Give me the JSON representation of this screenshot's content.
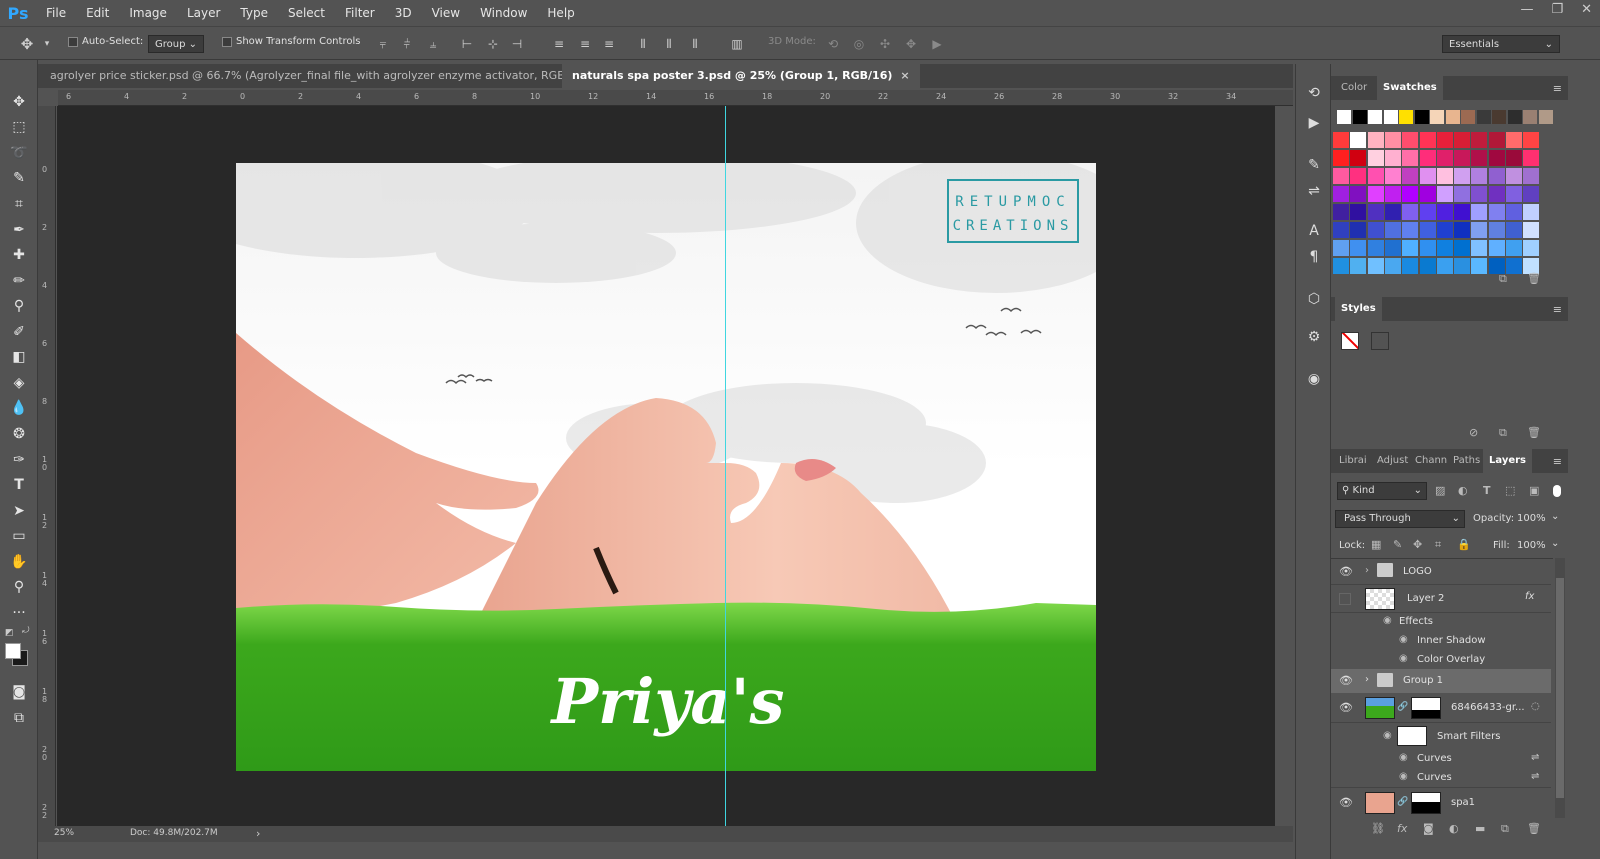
{
  "app": {
    "logo": "Ps"
  },
  "menu": [
    "File",
    "Edit",
    "Image",
    "Layer",
    "Type",
    "Select",
    "Filter",
    "3D",
    "View",
    "Window",
    "Help"
  ],
  "window_controls": {
    "minimize": "—",
    "restore": "❐",
    "close": "✕"
  },
  "options": {
    "auto_select_label": "Auto-Select:",
    "auto_select_value": "Group",
    "show_transform_label": "Show Transform Controls",
    "mode_3d_label": "3D Mode:",
    "workspace_value": "Essentials"
  },
  "tabs": [
    {
      "label": "agrolyer price sticker.psd @ 66.7% (Agrolyzer_final file_with agrolyzer enzyme activator, RGB/8)",
      "close": "×",
      "active": false
    },
    {
      "label": "naturals spa poster 3.psd @ 25% (Group 1, RGB/16)",
      "close": "×",
      "active": true
    }
  ],
  "ruler": {
    "h_labels": [
      "6",
      "4",
      "2",
      "0",
      "2",
      "4",
      "6",
      "8",
      "10",
      "12",
      "14",
      "16",
      "18",
      "20",
      "22",
      "24",
      "26",
      "28",
      "30",
      "32",
      "34"
    ],
    "v_labels": [
      "0",
      "2",
      "4",
      "6",
      "8",
      "1 0",
      "1 2",
      "1 4",
      "1 6",
      "1 8",
      "2 0",
      "2 2"
    ]
  },
  "poster": {
    "logo_line1": "RETUPMOC",
    "logo_line2": "CREATIONS",
    "brand_script": "Priya's"
  },
  "status": {
    "zoom": "25%",
    "doc": "Doc: 49.8M/202.7M",
    "arrow": "›"
  },
  "panels": {
    "color_tab": "Color",
    "swatches_tab": "Swatches",
    "styles_tab": "Styles",
    "layer_tabs": [
      "Librai",
      "Adjust",
      "Chann",
      "Paths",
      "Layers"
    ],
    "kind_label": "Kind",
    "blend_mode": "Pass Through",
    "opacity_label": "Opacity:",
    "opacity_value": "100%",
    "lock_label": "Lock:",
    "fill_label": "Fill:",
    "fill_value": "100%"
  },
  "swatches": {
    "top_row": [
      "#ffffff",
      "#000000",
      "#ffffff",
      "#ffffff",
      "#ffe000",
      "#000000",
      "#f5d5b8",
      "#e8b58f",
      "#9c6a52",
      "#3a3a3a",
      "#4a3a30",
      "#2d2d2d",
      "#9a8072",
      "#b09a88"
    ],
    "rows": [
      [
        "#ff3b3b",
        "#ffffff",
        "#ffb3c0",
        "#ff8fa3",
        "#ff4d6d",
        "#ff3355",
        "#e8203a",
        "#d81e35",
        "#c01c3c",
        "#b01838",
        "#ff6b6b",
        "#ff4444"
      ],
      [
        "#ff2020",
        "#d00010",
        "#ffd0e0",
        "#ffb0d0",
        "#ff6fa8",
        "#ff2d7a",
        "#e0206a",
        "#c8185a",
        "#b0104a",
        "#a00840",
        "#9a0a3a",
        "#ff3070"
      ],
      [
        "#ff5aa0",
        "#ff3080",
        "#ff50b0",
        "#ff80d0",
        "#c040c0",
        "#e090f0",
        "#ffc0e0",
        "#d0a0f0",
        "#b080e0",
        "#9060d0",
        "#c090e0",
        "#a070d0"
      ],
      [
        "#a020e0",
        "#8010c0",
        "#e040ff",
        "#c020f0",
        "#b000ff",
        "#a000e0",
        "#d0a0ff",
        "#9070e0",
        "#8050d0",
        "#7030c0",
        "#8060e0",
        "#6040c0"
      ],
      [
        "#4020a0",
        "#3010a0",
        "#5030c0",
        "#3020b0",
        "#8060f0",
        "#6040f0",
        "#5020e0",
        "#4010d0",
        "#a0a0ff",
        "#8080f0",
        "#6060e0",
        "#c0d0ff"
      ],
      [
        "#3040c0",
        "#2030b0",
        "#4050d0",
        "#5070e0",
        "#6080f0",
        "#4060e0",
        "#2040d0",
        "#1030c0",
        "#80a0f0",
        "#6080e0",
        "#4060d0",
        "#d0e0ff"
      ],
      [
        "#60a0f0",
        "#4090f0",
        "#3080e0",
        "#2070d0",
        "#50b0ff",
        "#3090f0",
        "#1080e0",
        "#0070d0",
        "#80c0ff",
        "#60b0ff",
        "#40a0f0",
        "#a0d0ff"
      ],
      [
        "#2090e0",
        "#50b0f0",
        "#70c0ff",
        "#4aa8f0",
        "#1a8ae0",
        "#0a7ad0",
        "#3aa0f0",
        "#2a90e0",
        "#5ab8ff",
        "#0060c0",
        "#1070d0",
        "#c0e0ff"
      ]
    ]
  },
  "layers": [
    {
      "name": "LOGO",
      "kind": "group",
      "visible": true
    },
    {
      "name": "Layer 2",
      "kind": "layer",
      "visible": false,
      "fx": "fx"
    },
    {
      "name": "Effects",
      "kind": "effects-header"
    },
    {
      "name": "Inner Shadow",
      "kind": "effect"
    },
    {
      "name": "Color Overlay",
      "kind": "effect"
    },
    {
      "name": "Group 1",
      "kind": "group",
      "visible": true,
      "selected": true
    },
    {
      "name": "68466433-gr...",
      "kind": "smart",
      "visible": true
    },
    {
      "name": "Smart Filters",
      "kind": "filters-header"
    },
    {
      "name": "Curves",
      "kind": "filter"
    },
    {
      "name": "Curves",
      "kind": "filter"
    },
    {
      "name": "spa1",
      "kind": "smart",
      "visible": true
    }
  ]
}
